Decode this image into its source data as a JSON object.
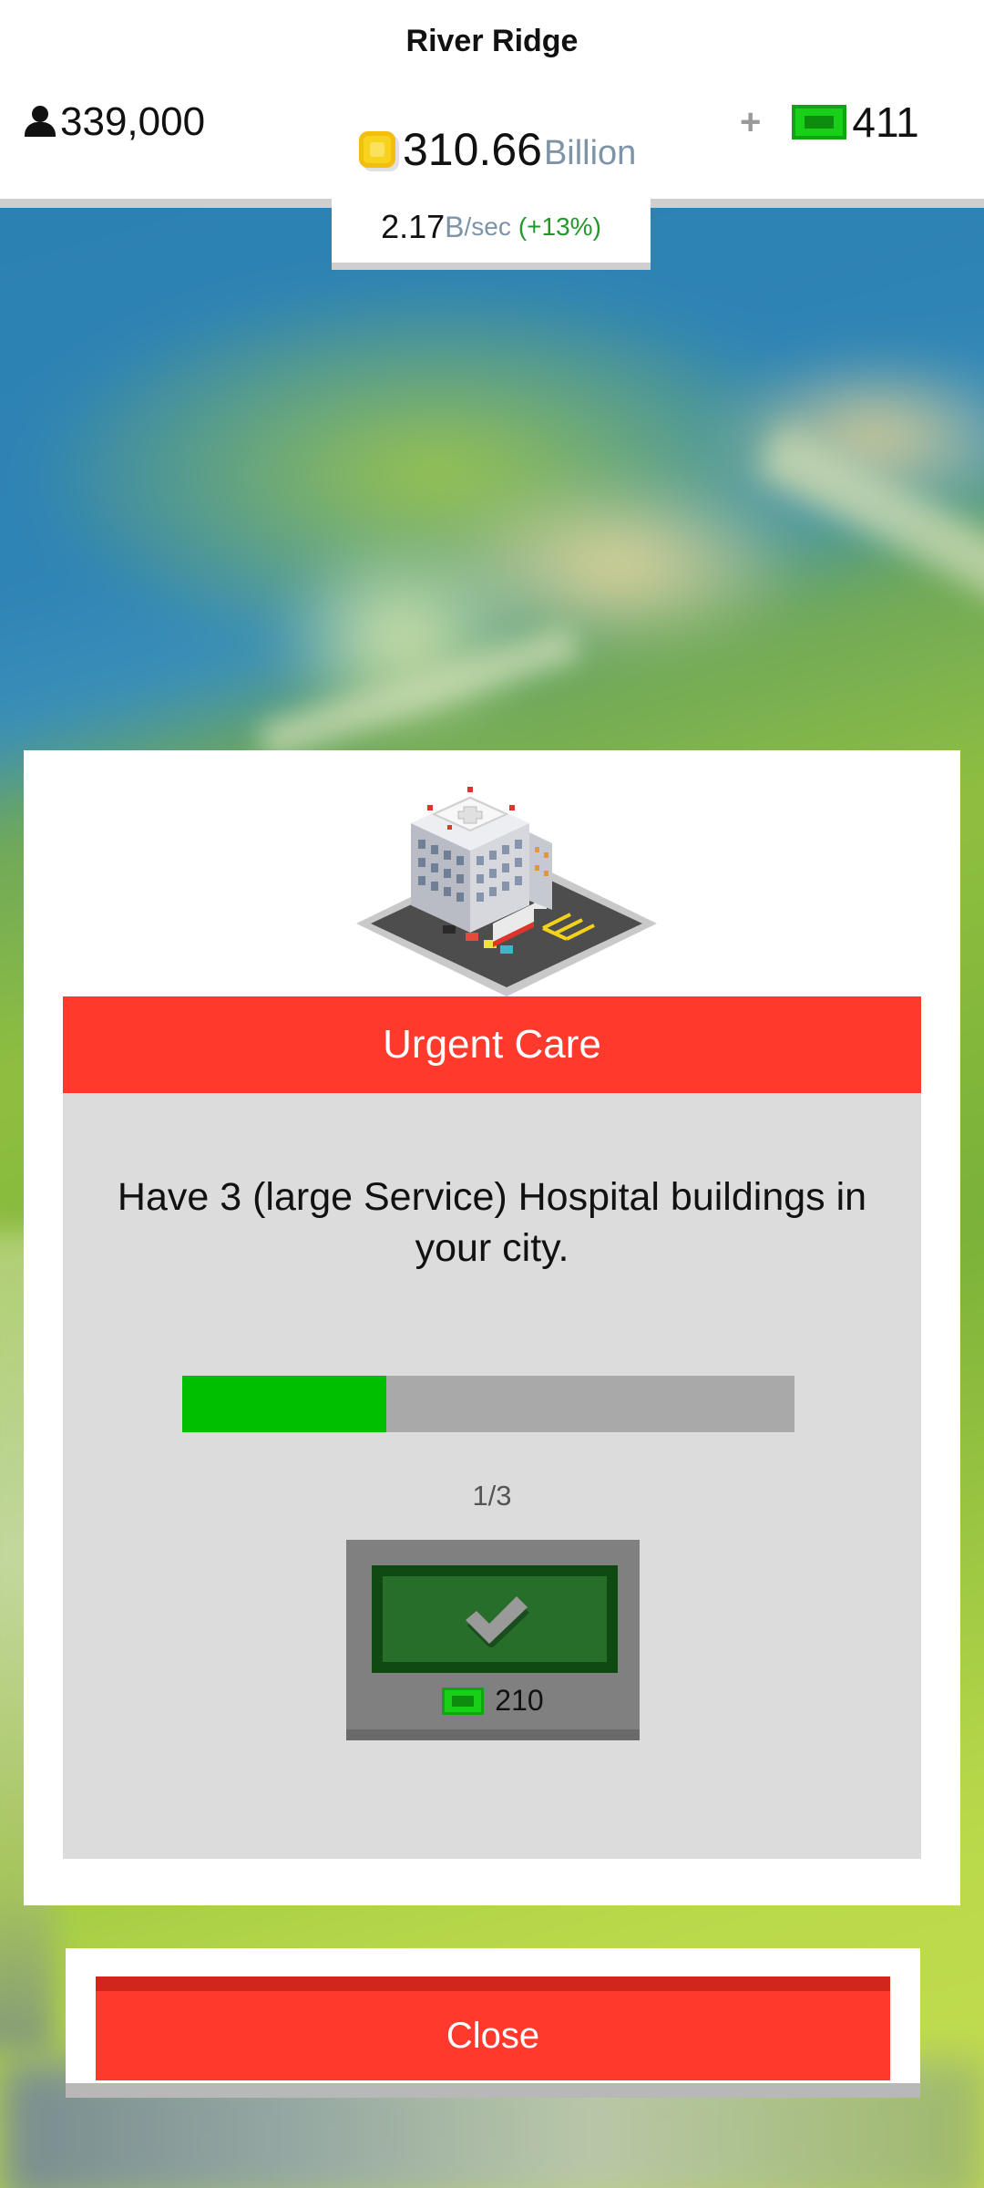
{
  "header": {
    "city_name": "River Ridge",
    "population": "339,000",
    "coins_value": "310.66",
    "coins_unit": "Billion",
    "income_value": "2.17",
    "income_unit": "B",
    "income_per": "/sec",
    "income_change": "(+13%)",
    "plus_label": "+",
    "cash": "411"
  },
  "achievement": {
    "title": "Urgent Care",
    "description": "Have 3 (large Service) Hospital buildings in your city.",
    "progress_current": 1,
    "progress_total": 3,
    "progress_text": "1/3",
    "reward": "210"
  },
  "actions": {
    "close_label": "Close"
  },
  "icons": {
    "population": "person-icon",
    "coins": "coin-icon",
    "cash": "cash-icon",
    "claim": "checkmark-icon",
    "building": "hospital-building"
  },
  "colors": {
    "title_bar": "#ff3a2c",
    "progress_fill": "#00bf00",
    "progress_track": "#a9a9a9",
    "claim_inner": "#266e2a",
    "income_change": "#1f9a2a",
    "unit_text": "#7d94a8"
  }
}
